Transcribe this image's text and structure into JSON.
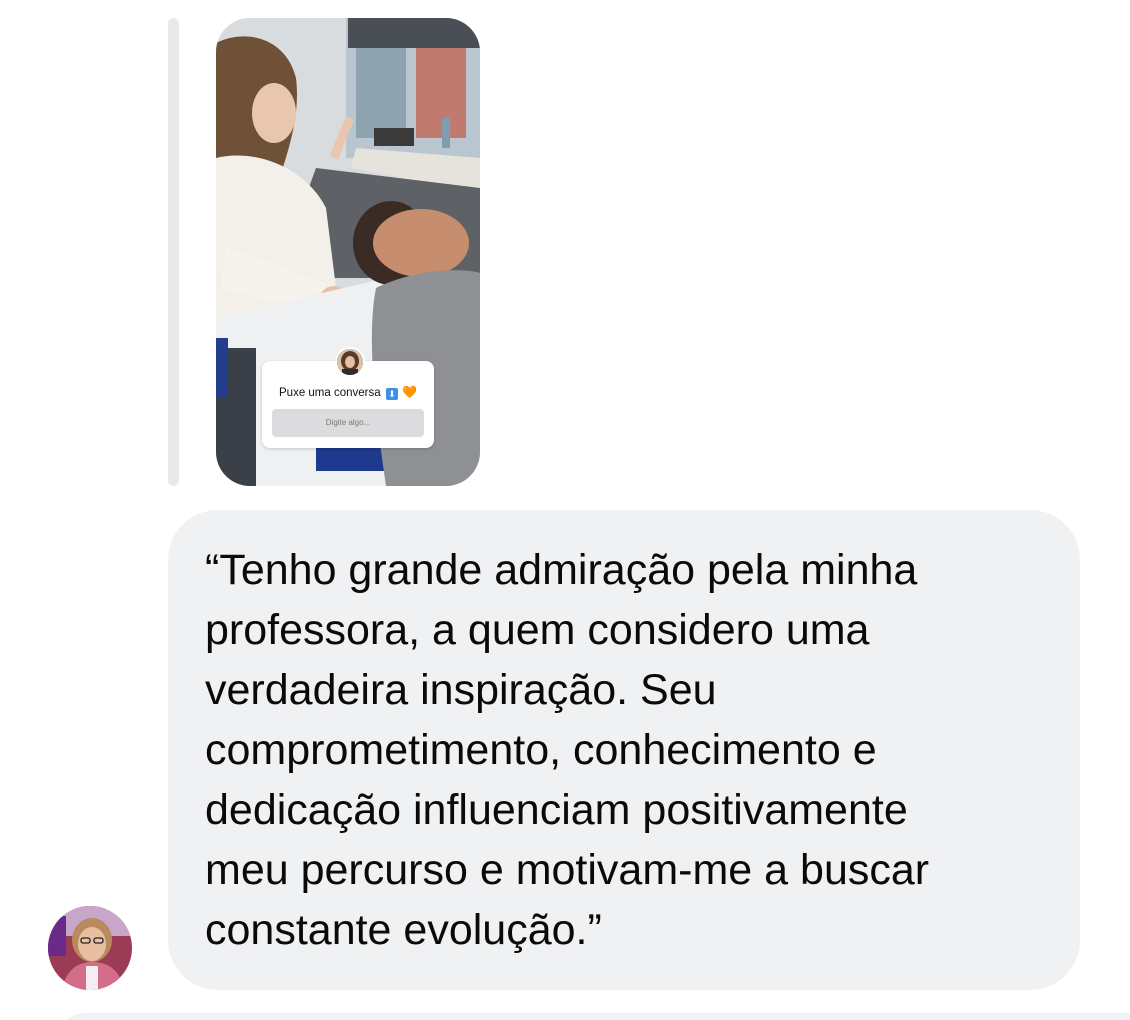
{
  "story_reply": {
    "image_description_icon": "story-photo",
    "sticker": {
      "title": "Puxe uma conversa",
      "emoji_down": "⬇",
      "emoji_heart": "🧡",
      "input_placeholder": "Digite algo..."
    }
  },
  "message": {
    "text": "“Tenho grande admiração pela minha\nprofessora, a quem considero uma\nverdadeira inspiração. Seu\ncomprometimento, conhecimento e\ndedicação influenciam positivamente\nmeu percurso e motivam-me a buscar\nconstante evolução.”"
  },
  "colors": {
    "bubble_background": "#f0f1f3",
    "text": "#0a0a0a",
    "reply_bar": "#e8e9eb"
  }
}
